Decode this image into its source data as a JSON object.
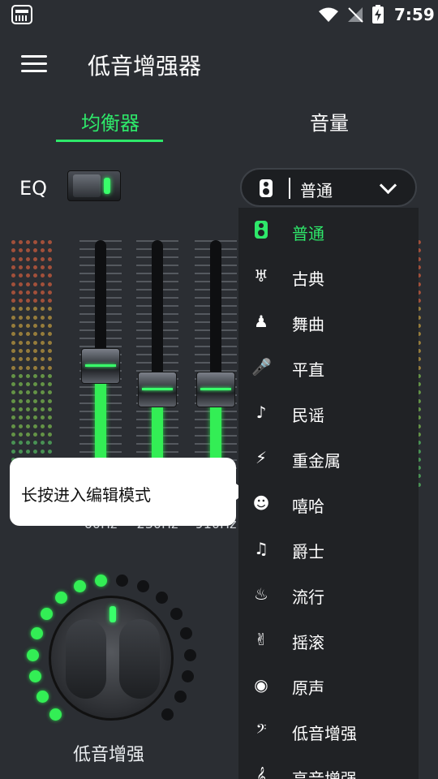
{
  "status_bar": {
    "time": "7:59"
  },
  "app_bar": {
    "title": "低音增强器"
  },
  "tabs": [
    {
      "label": "均衡器",
      "active": true
    },
    {
      "label": "音量",
      "active": false
    }
  ],
  "eq": {
    "label": "EQ",
    "enabled": true
  },
  "preset": {
    "selected": "普通"
  },
  "sliders": [
    {
      "freq": "60Hz",
      "level": 0.45
    },
    {
      "freq": "230Hz",
      "level": 0.35
    },
    {
      "freq": "910Hz",
      "level": 0.35
    }
  ],
  "tooltip": {
    "text": "长按进入编辑模式"
  },
  "knob": {
    "label": "低音增强",
    "level": 0.5
  },
  "dropdown": {
    "items": [
      {
        "label": "普通",
        "icon": "speaker-icon",
        "active": true
      },
      {
        "label": "古典",
        "icon": "harp-icon",
        "glyph": "♅"
      },
      {
        "label": "舞曲",
        "icon": "dance-icon",
        "glyph": "♟"
      },
      {
        "label": "平直",
        "icon": "microphone-icon",
        "glyph": "🎤"
      },
      {
        "label": "民谣",
        "icon": "folk-guitar-icon",
        "glyph": "♪"
      },
      {
        "label": "重金属",
        "icon": "electric-guitar-icon",
        "glyph": "⚡"
      },
      {
        "label": "嘻哈",
        "icon": "hiphop-face-icon",
        "glyph": "☻"
      },
      {
        "label": "爵士",
        "icon": "saxophone-icon",
        "glyph": "♫"
      },
      {
        "label": "流行",
        "icon": "flame-icon",
        "glyph": "♨"
      },
      {
        "label": "摇滚",
        "icon": "rock-hand-icon",
        "glyph": "✌"
      },
      {
        "label": "原声",
        "icon": "disc-icon",
        "glyph": "◉"
      },
      {
        "label": "低音增强",
        "icon": "bass-clef-icon",
        "glyph": "𝄢"
      },
      {
        "label": "高音增强",
        "icon": "treble-clef-icon",
        "glyph": "𝄞"
      }
    ]
  },
  "colors": {
    "accent": "#2ee86a",
    "background": "#2b2e33"
  }
}
